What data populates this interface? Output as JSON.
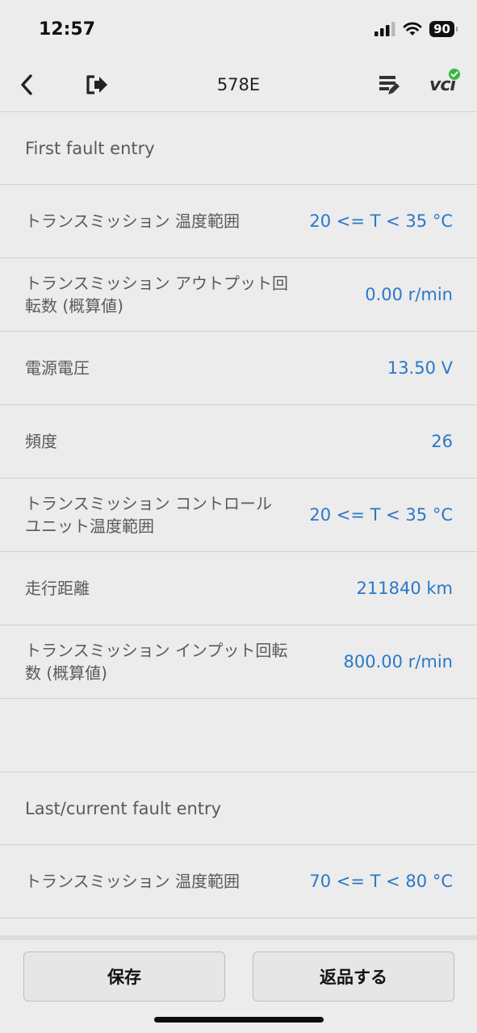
{
  "status_bar": {
    "time": "12:57",
    "battery": "90",
    "icons": [
      "signal-icon",
      "wifi-icon",
      "battery-icon"
    ]
  },
  "nav": {
    "title": "578E",
    "back_icon": "chevron-left-icon",
    "exit_icon": "exit-icon",
    "report_icon": "report-edit-icon",
    "vci_label": "vci"
  },
  "sections": [
    {
      "header": "First fault entry",
      "rows": [
        {
          "label": "トランスミッション 温度範囲",
          "value": "20 <= T < 35 °C"
        },
        {
          "label": "トランスミッション アウトプット回転数 (概算値)",
          "value": "0.00 r/min"
        },
        {
          "label": "電源電圧",
          "value": "13.50 V"
        },
        {
          "label": "頻度",
          "value": "26"
        },
        {
          "label": "トランスミッション コントロール ユニット温度範囲",
          "value": "20 <= T < 35 °C"
        },
        {
          "label": "走行距離",
          "value": "211840 km"
        },
        {
          "label": "トランスミッション インプット回転数 (概算値)",
          "value": "800.00 r/min"
        }
      ]
    },
    {
      "header": "Last/current fault entry",
      "rows": [
        {
          "label": "トランスミッション 温度範囲",
          "value": "70 <= T < 80 °C"
        }
      ]
    }
  ],
  "buttons": {
    "save": "保存",
    "return": "返品する"
  },
  "colors": {
    "background": "#ececec",
    "value_blue": "#2a78c8",
    "label_gray": "#5a5a5a",
    "vci_check_green": "#3bb54a"
  }
}
